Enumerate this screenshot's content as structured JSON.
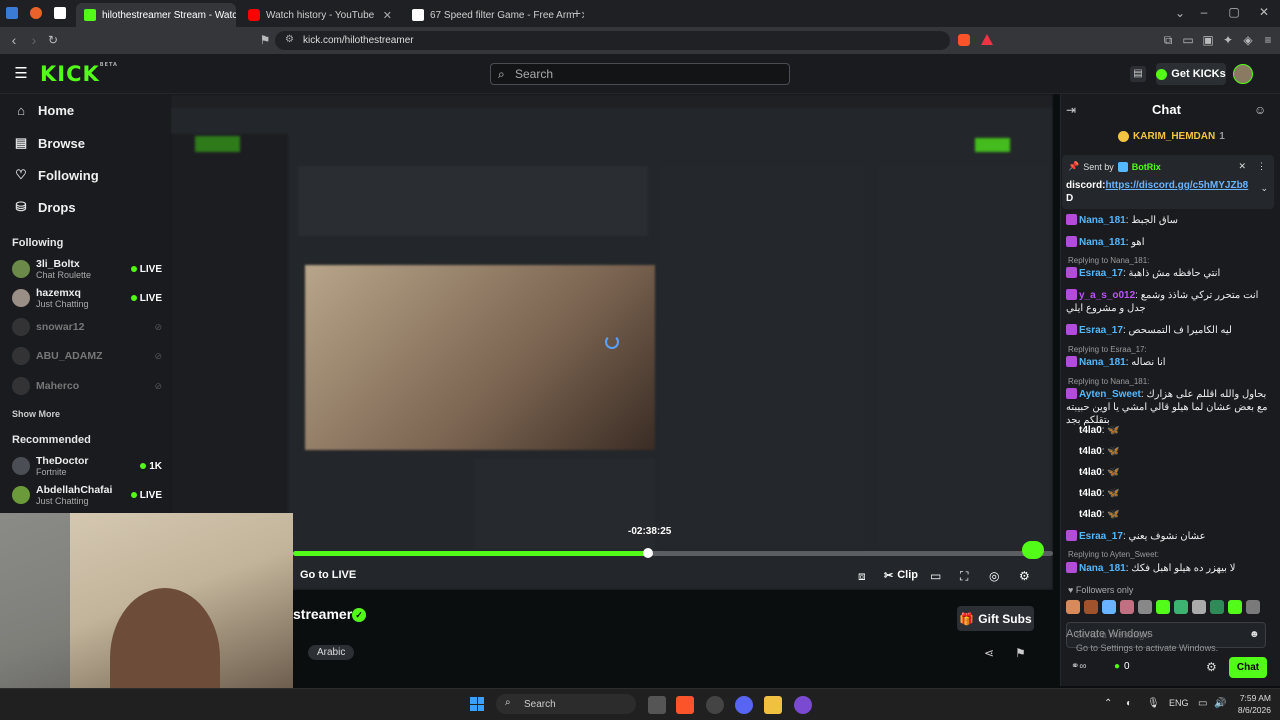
{
  "browser": {
    "tabs": [
      {
        "label": "hilothestreamer Stream - Watch",
        "active": true,
        "color": "#53fc18"
      },
      {
        "label": "Watch history - YouTube",
        "active": false,
        "color": "#ff0000"
      },
      {
        "label": "67 Speed filter Game - Free Arm",
        "active": false,
        "color": "#ffffff"
      }
    ],
    "url": "kick.com/hilothestreamer"
  },
  "header": {
    "logo": "KICK",
    "logo_sup": "BETA",
    "search_placeholder": "Search",
    "get_kicks": "Get KICKs"
  },
  "sidebar": {
    "nav": [
      {
        "label": "Home",
        "icon": "home-icon"
      },
      {
        "label": "Browse",
        "icon": "browse-icon"
      },
      {
        "label": "Following",
        "icon": "heart-icon"
      },
      {
        "label": "Drops",
        "icon": "drops-icon"
      }
    ],
    "following_title": "Following",
    "following": [
      {
        "name": "3li_Boltx",
        "category": "Chat Roulette",
        "status": "LIVE"
      },
      {
        "name": "hazemxq",
        "category": "Just Chatting",
        "status": "LIVE"
      },
      {
        "name": "snowar12",
        "category": "",
        "status": ""
      },
      {
        "name": "ABU_ADAMZ",
        "category": "",
        "status": ""
      },
      {
        "name": "Maherco",
        "category": "",
        "status": ""
      }
    ],
    "show_more": "Show More",
    "recommended_title": "Recommended",
    "recommended": [
      {
        "name": "TheDoctor",
        "category": "Fortnite",
        "status": "1K"
      },
      {
        "name": "AbdellahChafai",
        "category": "Just Chatting",
        "status": "LIVE"
      }
    ]
  },
  "player": {
    "time_tooltip": "-02:38:25",
    "progress_fraction": 0.465,
    "go_live": "Go to LIVE",
    "clip": "Clip"
  },
  "stream": {
    "name_partial": "streamer",
    "tag": "Arabic",
    "gift_subs": "Gift Subs"
  },
  "chat": {
    "title": "Chat",
    "top_user": "KARIM_HEMDAN",
    "top_count": "1",
    "pinned": {
      "sent_by_label": "Sent by",
      "sender": "BotRix",
      "text_prefix": "discord:",
      "link": "https://discord.gg/c5hMYJZb8",
      "link_cont": "D"
    },
    "messages": [
      {
        "type": "msg",
        "user": "Nana_181",
        "color": "#53b8ff",
        "text": "ساق الجبط"
      },
      {
        "type": "msg",
        "user": "Nana_181",
        "color": "#53b8ff",
        "text": "اهو"
      },
      {
        "type": "reply",
        "text": "Replying to Nana_181:"
      },
      {
        "type": "msg",
        "user": "Esraa_17",
        "color": "#53b8ff",
        "text": "انتي حافظه مش ذاهبة"
      },
      {
        "type": "msg",
        "user": "y_a_s_o012",
        "color": "#c050ff",
        "text": "انت متحرر تركي شاذذ وشمع جدل و مشروع ايلي"
      },
      {
        "type": "msg",
        "user": "Esraa_17",
        "color": "#53b8ff",
        "text": "ليه الكاميرا ف التمسحص"
      },
      {
        "type": "reply",
        "text": "Replying to Esraa_17:"
      },
      {
        "type": "msg",
        "user": "Nana_181",
        "color": "#53b8ff",
        "text": "انا نصاله"
      },
      {
        "type": "reply",
        "text": "Replying to Nana_181:"
      },
      {
        "type": "msg",
        "user": "Ayten_Sweet",
        "color": "#53b8ff",
        "text": "بحاول والله اقللم على هزارك مع بعض عشان لما هيلو قالي امشي يا اوين حبيبته بتقلكم بجد"
      },
      {
        "type": "msg",
        "user": "t4la0",
        "color": "#ffffff",
        "text": "🦋"
      },
      {
        "type": "msg",
        "user": "t4la0",
        "color": "#ffffff",
        "text": "🦋"
      },
      {
        "type": "msg",
        "user": "t4la0",
        "color": "#ffffff",
        "text": "🦋"
      },
      {
        "type": "msg",
        "user": "t4la0",
        "color": "#ffffff",
        "text": "🦋"
      },
      {
        "type": "msg",
        "user": "t4la0",
        "color": "#ffffff",
        "text": "🦋"
      },
      {
        "type": "msg",
        "user": "Esraa_17",
        "color": "#53b8ff",
        "text": "عشان نشوف يعني"
      },
      {
        "type": "reply",
        "text": "Replying to Ayten_Sweet:"
      },
      {
        "type": "msg",
        "user": "Nana_181",
        "color": "#53b8ff",
        "text": "لا بيهزر ده هيلو اهبل فكك"
      }
    ],
    "followers_only": "Followers only",
    "input_placeholder": "Send a message",
    "activate_title": "Activate Windows",
    "activate_sub": "Go to Settings to activate Windows.",
    "points": "0",
    "chat_button": "Chat"
  },
  "taskbar": {
    "search": "Search",
    "lang": "ENG",
    "time": "7:59 AM",
    "date": "8/6/2026"
  }
}
